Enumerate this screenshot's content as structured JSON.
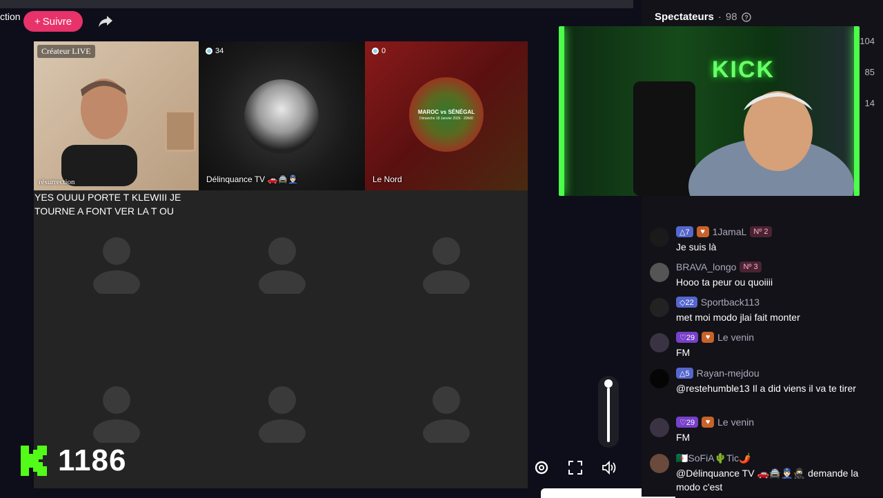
{
  "header": {
    "title_snippet": "ction",
    "follow_label": "Suivre",
    "follow_plus": "+"
  },
  "grid": {
    "creator": {
      "badge": "Créateur LIVE",
      "name": "résurrection"
    },
    "guest1": {
      "count": "34",
      "name": "Délinquance TV 🚗🚔👮🏻‍♂️"
    },
    "guest2": {
      "count": "0",
      "name": "Le Nord",
      "poster_title": "MAROC vs SÉNÉGAL",
      "poster_sub": "Dimanche 18 Janvier 2026 · 20h00"
    }
  },
  "counter": {
    "value": "1186"
  },
  "volume": {
    "level": 0.9
  },
  "sidebar": {
    "title": "Spectateurs",
    "sep": "·",
    "count": "98",
    "side_numbers": [
      "104",
      "85",
      "14"
    ]
  },
  "camera": {
    "sign": "KICK"
  },
  "chat": {
    "first_message": "YES OUUU PORTE T KLEWIII JE TOURNE A FONT VER LA T OU",
    "messages": [
      {
        "badges": [
          {
            "type": "blue",
            "text": "△7"
          },
          {
            "type": "heart",
            "text": "♥"
          }
        ],
        "user": "1JamaL",
        "rank": "Nº 2",
        "text": "Je suis là",
        "avatar_color": "#1a1a1a"
      },
      {
        "badges": [],
        "user": "BRAVA_longo",
        "rank": "Nº 3",
        "text": "Hooo ta peur ou quoiiii",
        "avatar_color": "#555"
      },
      {
        "badges": [
          {
            "type": "blue",
            "text": "◇22"
          }
        ],
        "user": "Sportback113",
        "rank": "",
        "text": "met moi modo jlai fait monter",
        "avatar_color": "#222"
      },
      {
        "badges": [
          {
            "type": "purple",
            "text": "♡29"
          },
          {
            "type": "heart",
            "text": "♥"
          }
        ],
        "user": "Le venin",
        "rank": "",
        "text": "FM",
        "avatar_color": "#3a3344"
      },
      {
        "badges": [
          {
            "type": "blue",
            "text": "△5"
          }
        ],
        "user": "Rayan-mejdou",
        "rank": "",
        "text": "@restehumble13 Il a did viens il va te tirer",
        "avatar_color": "#050505"
      },
      {
        "badges": [
          {
            "type": "purple",
            "text": "♡29"
          },
          {
            "type": "heart",
            "text": "♥"
          }
        ],
        "user": "Le venin",
        "rank": "",
        "text": "FM",
        "avatar_color": "#3a3344"
      },
      {
        "badges": [],
        "user": "🇩🇿SoFiA🌵Tic🌶️",
        "rank": "",
        "text": "@Délinquance TV 🚗🚔👮🏻‍♂️🥷🏻 demande la modo c'est",
        "avatar_color": "#6a4a3a"
      }
    ]
  }
}
